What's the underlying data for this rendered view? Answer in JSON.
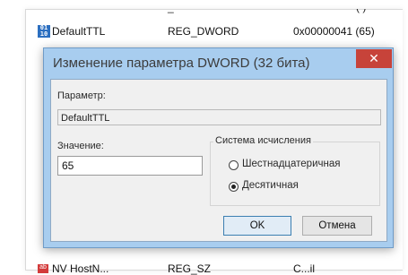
{
  "background_list": {
    "top_clipped": {
      "type": "_",
      "value": "( )"
    },
    "row": {
      "icon": "dword-icon",
      "name": "DefaultTTL",
      "type": "REG_DWORD",
      "value": "0x00000041 (65)"
    },
    "bottom_clipped": {
      "name": "NV HostN...",
      "type": "REG_SZ",
      "value": "C...il"
    }
  },
  "dialog": {
    "title": "Изменение параметра DWORD (32 бита)",
    "close_icon": "close-icon",
    "param_label": "Параметр:",
    "param_value": "DefaultTTL",
    "value_label": "Значение:",
    "value_input": "65",
    "base_group": {
      "title": "Система исчисления",
      "options": [
        {
          "label": "Шестнадцатеричная",
          "selected": false
        },
        {
          "label": "Десятичная",
          "selected": true
        }
      ]
    },
    "ok_label": "OK",
    "cancel_label": "Отмена"
  }
}
